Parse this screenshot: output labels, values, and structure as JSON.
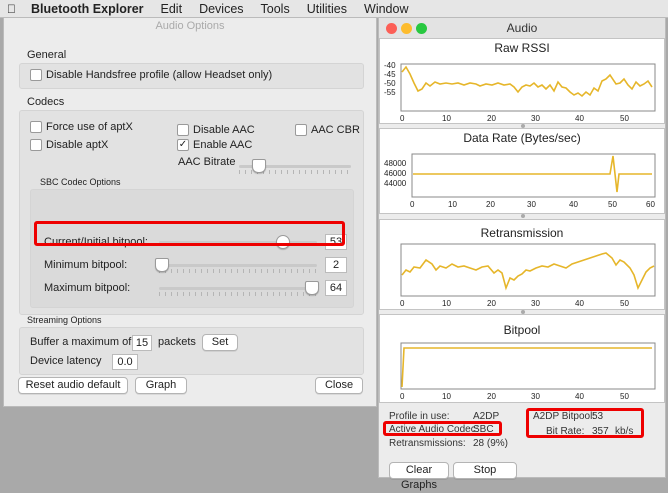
{
  "menubar": {
    "app": "Bluetooth Explorer",
    "items": [
      "Edit",
      "Devices",
      "Tools",
      "Utilities",
      "Window"
    ]
  },
  "audio_options": {
    "title": "Audio Options",
    "general": {
      "heading": "General",
      "disable_handsfree": "Disable Handsfree profile (allow Headset only)"
    },
    "codecs": {
      "heading": "Codecs",
      "force_aptx": "Force use of aptX",
      "disable_aptx": "Disable aptX",
      "disable_aac": "Disable AAC",
      "enable_aac": "Enable AAC",
      "aac_cbr": "AAC CBR",
      "aac_bitrate": "AAC Bitrate",
      "sbc_heading": "SBC Codec Options",
      "current_bitpool_label": "Current/Initial bitpool:",
      "current_bitpool_value": "53",
      "min_bitpool_label": "Minimum bitpool:",
      "min_bitpool_value": "2",
      "max_bitpool_label": "Maximum bitpool:",
      "max_bitpool_value": "64"
    },
    "streaming": {
      "heading": "Streaming Options",
      "buffer_prefix": "Buffer a maximum of",
      "buffer_value": "15",
      "buffer_suffix": "packets",
      "set": "Set",
      "latency_label": "Device latency",
      "latency_value": "0.0"
    },
    "buttons": {
      "reset": "Reset audio default",
      "graph": "Graph",
      "close": "Close"
    }
  },
  "audio_window": {
    "title": "Audio",
    "charts": [
      {
        "title": "Raw RSSI",
        "yticks": [
          "-40",
          "-45",
          "-50",
          "-55"
        ],
        "xticks": [
          "0",
          "10",
          "20",
          "30",
          "40",
          "50"
        ]
      },
      {
        "title": "Data Rate (Bytes/sec)",
        "yticks": [
          "48000",
          "46000",
          "44000"
        ],
        "xticks": [
          "0",
          "10",
          "20",
          "30",
          "40",
          "50",
          "60"
        ]
      },
      {
        "title": "Retransmission",
        "yticks": [],
        "xticks": [
          "0",
          "10",
          "20",
          "30",
          "40",
          "50"
        ]
      },
      {
        "title": "Bitpool",
        "yticks": [],
        "xticks": [
          "0",
          "10",
          "20",
          "30",
          "40",
          "50"
        ]
      }
    ],
    "info": {
      "profile_label": "Profile in use:",
      "profile_value": "A2DP",
      "codec_label": "Active Audio Codec:",
      "codec_value": "SBC",
      "retrans_label": "Retransmissions:",
      "retrans_value": "28 (9%)",
      "a2dp_bitpool_label": "A2DP Bitpool:",
      "a2dp_bitpool_value": "53",
      "bitrate_label": "Bit Rate:",
      "bitrate_value": "357",
      "bitrate_unit": "kb/s"
    },
    "buttons": {
      "clear": "Clear Graphs",
      "stop": "Stop"
    }
  },
  "colors": {
    "line": "#e6b62a",
    "highlight": "#e00000"
  }
}
